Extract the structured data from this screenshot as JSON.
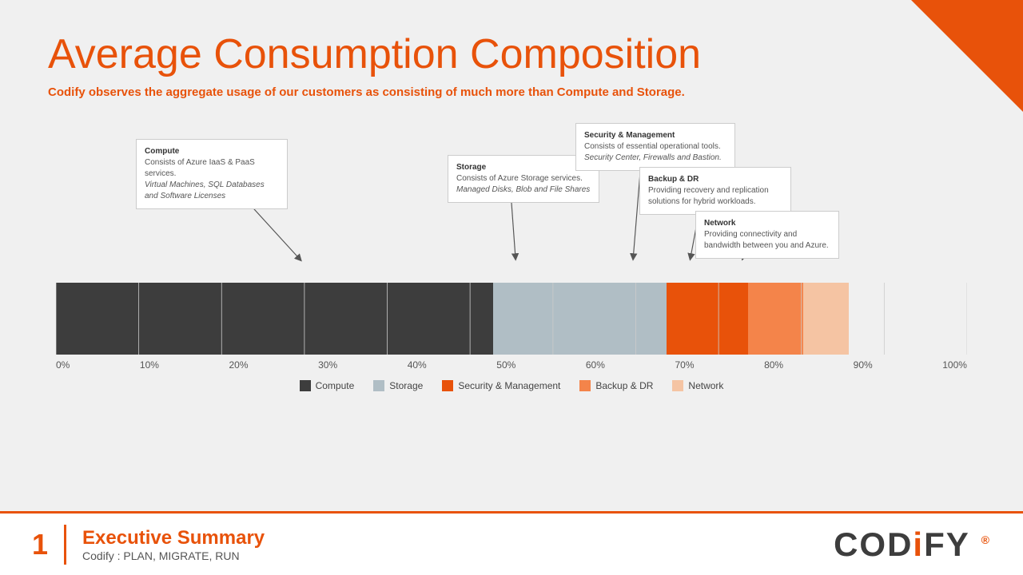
{
  "page": {
    "title": "Average Consumption Composition",
    "subtitle": "Codify observes the aggregate usage of our customers as consisting of much more than Compute and Storage."
  },
  "annotations": {
    "compute": {
      "title": "Compute",
      "desc": "Consists of Azure IaaS & PaaS services.",
      "detail": "Virtual Machines, SQL Databases and Software Licenses"
    },
    "storage": {
      "title": "Storage",
      "desc": "Consists of Azure Storage services.",
      "detail": "Managed Disks, Blob and File Shares"
    },
    "security": {
      "title": "Security & Management",
      "desc": "Consists of essential operational tools.",
      "detail": "Security Center, Firewalls and Bastion."
    },
    "backup": {
      "title": "Backup & DR",
      "desc": "Providing recovery and replication solutions for hybrid workloads."
    },
    "network": {
      "title": "Network",
      "desc": "Providing connectivity and bandwidth between you and Azure."
    }
  },
  "xaxis": {
    "labels": [
      "0%",
      "10%",
      "20%",
      "30%",
      "40%",
      "50%",
      "60%",
      "70%",
      "80%",
      "90%",
      "100%"
    ]
  },
  "legend": {
    "items": [
      {
        "label": "Compute",
        "color": "#3d3d3d"
      },
      {
        "label": "Storage",
        "color": "#b0bec5"
      },
      {
        "label": "Security & Management",
        "color": "#e8520a"
      },
      {
        "label": "Backup & DR",
        "color": "#f4844a"
      },
      {
        "label": "Network",
        "color": "#f5c4a3"
      }
    ]
  },
  "footer": {
    "number": "1",
    "title": "Executive Summary",
    "subtitle": "Codify : PLAN, MIGRATE, RUN",
    "logo": "CODiFY"
  }
}
